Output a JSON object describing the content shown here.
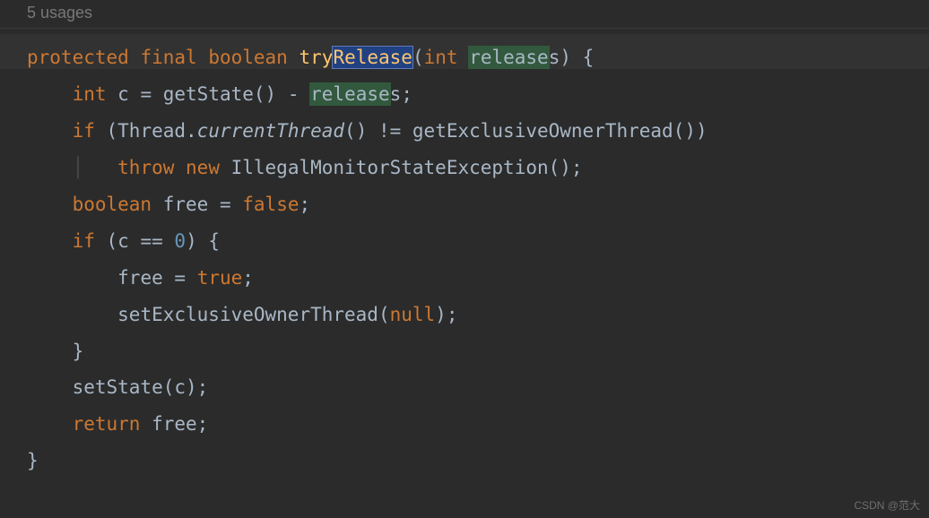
{
  "hint": {
    "usages": "5 usages"
  },
  "code": {
    "line1": {
      "kw_protected": "protected",
      "kw_final": "final",
      "kw_boolean": "boolean",
      "method_try": "try",
      "method_release": "Release",
      "paren_open": "(",
      "kw_int": "int",
      "param_release": "release",
      "param_s": "s",
      "paren_close": ")",
      "brace_open": " {"
    },
    "line2": {
      "kw_int": "int",
      "var_c": " c ",
      "eq": "=",
      "call": " getState() ",
      "minus": "-",
      "sp": " ",
      "rel": "release",
      "s": "s",
      "semi": ";"
    },
    "line3": {
      "kw_if": "if",
      "open": " (Thread.",
      "italic": "currentThread",
      "mid": "() != getExclusiveOwnerThread())"
    },
    "line4": {
      "kw_throw": "throw",
      "sp1": " ",
      "kw_new": "new",
      "rest": " IllegalMonitorStateException();"
    },
    "line5": {
      "kw_boolean": "boolean",
      "var": " free ",
      "eq": "=",
      "sp": " ",
      "false": "false",
      "semi": ";"
    },
    "line6": {
      "kw_if": "if",
      "open": " (c ",
      "eqeq": "==",
      "sp": " ",
      "zero": "0",
      "close": ") {"
    },
    "line7": {
      "var": "free ",
      "eq": "=",
      "sp": " ",
      "true": "true",
      "semi": ";"
    },
    "line8": {
      "call": "setExclusiveOwnerThread(",
      "null": "null",
      "close": ");"
    },
    "line9": {
      "brace": "}"
    },
    "line10": {
      "call": "setState(c);"
    },
    "line11": {
      "kw_return": "return",
      "rest": " free;"
    },
    "line12": {
      "brace": "}"
    }
  },
  "watermark": "CSDN @范大"
}
